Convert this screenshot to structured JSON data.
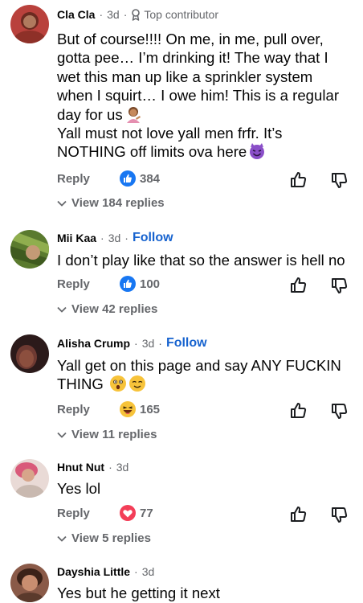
{
  "comments": [
    {
      "author": "Cla Cla",
      "time": "3d",
      "badge": "Top contributor",
      "text_lines": [
        "But of course!!!! On me, in me, pull over,",
        "gotta pee… I’m drinking it! The way that I",
        "wet this man up like a sprinkler system",
        "when I squirt… I owe him! This is a regular",
        "day for us",
        "Yall must not love yall men frfr. It’s",
        "NOTHING off limits ova here"
      ],
      "reply_label": "Reply",
      "reaction_icon": "like-icon",
      "reaction_count": "384",
      "view_replies": "View 184 replies"
    },
    {
      "author": "Mii Kaa",
      "time": "3d",
      "follow": "Follow",
      "text": "I don’t play like that so the answer is hell no",
      "reply_label": "Reply",
      "reaction_icon": "like-icon",
      "reaction_count": "100",
      "view_replies": "View 42 replies"
    },
    {
      "author": "Alisha Crump",
      "time": "3d",
      "follow": "Follow",
      "text_lines": [
        "Yall get on this page and say ANY FUCKIN",
        "THING"
      ],
      "reply_label": "Reply",
      "reaction_icon": "haha-icon",
      "reaction_count": "165",
      "view_replies": "View 11 replies"
    },
    {
      "author": "Hnut Nut",
      "time": "3d",
      "text": "Yes lol",
      "reply_label": "Reply",
      "reaction_icon": "love-icon",
      "reaction_count": "77",
      "view_replies": "View 5 replies"
    },
    {
      "author": "Dayshia Little",
      "time": "3d",
      "text": "Yes but he getting it next"
    }
  ],
  "colors": {
    "like_blue": "#1877f2",
    "love_red": "#f33e58",
    "follow_blue": "#1763cf",
    "secondary_text": "#65676b"
  }
}
